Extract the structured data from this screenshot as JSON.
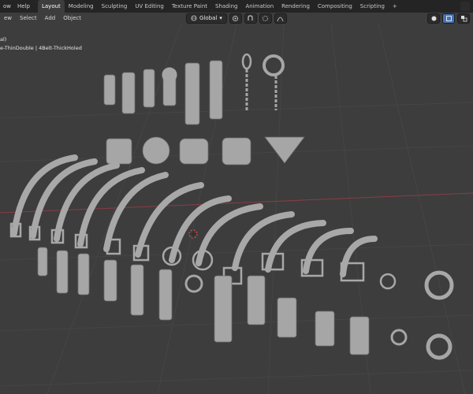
{
  "topbar": {
    "menu": [
      "ow",
      "Help"
    ],
    "tabs": [
      "Layout",
      "Modeling",
      "Sculpting",
      "UV Editing",
      "Texture Paint",
      "Shading",
      "Animation",
      "Rendering",
      "Compositing",
      "Scripting"
    ],
    "active_tab": "Layout",
    "add_tab": "+"
  },
  "viewport_header": {
    "menu": [
      "ew",
      "Select",
      "Add",
      "Object"
    ],
    "transform_orientation": "Global"
  },
  "viewport_overlay": {
    "line1": "al)",
    "line2": "e-ThinDouble | 4Belt-ThickHoled"
  },
  "colors": {
    "viewport_bg": "#3d3d3d",
    "grid": "#474747",
    "x_axis": "#8a3d45",
    "model": "#a6a6a6",
    "model_shadow": "#6e6e6e",
    "active_tab_bg": "#3d3d3d",
    "header_bg": "#242424",
    "accent": "#4772b3"
  },
  "icons": [
    "transform-pivot-icon",
    "snap-icon",
    "proportional-edit-icon",
    "falloff-icon",
    "view-gizmo-icon",
    "overlays-icon",
    "xray-icon"
  ]
}
